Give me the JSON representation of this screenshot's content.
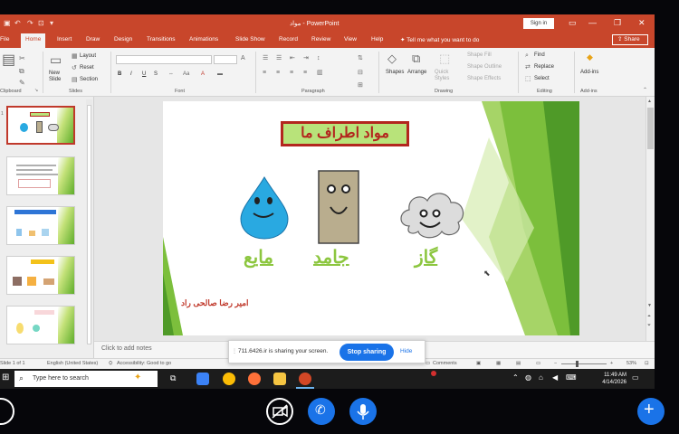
{
  "window": {
    "title": "مواد - PowerPoint",
    "sign_in": "Sign in",
    "share": "Share",
    "tell_me": "Tell me what you want to do"
  },
  "tabs": [
    "File",
    "Home",
    "Insert",
    "Draw",
    "Design",
    "Transitions",
    "Animations",
    "Slide Show",
    "Record",
    "Review",
    "View",
    "Help"
  ],
  "ribbon": {
    "clipboard_label": "Clipboard",
    "slides": {
      "new_slide": "New Slide",
      "layout": "Layout",
      "reset": "Reset",
      "section": "Section",
      "label": "Slides"
    },
    "font": {
      "bold": "B",
      "italic": "I",
      "underline": "U",
      "strike": "S",
      "label": "Font"
    },
    "paragraph_label": "Paragraph",
    "drawing": {
      "shapes": "Shapes",
      "arrange": "Arrange",
      "quick_styles": "Quick Styles",
      "fill": "Shape Fill",
      "outline": "Shape Outline",
      "effects": "Shape Effects",
      "label": "Drawing"
    },
    "editing": {
      "find": "Find",
      "replace": "Replace",
      "select": "Select",
      "label": "Editing"
    },
    "addins": {
      "button": "Add-ins",
      "label": "Add-ins"
    }
  },
  "slide": {
    "title": "مواد اطراف ما",
    "words": {
      "liquid": "مایع",
      "solid": "جامد",
      "gas": "گاز"
    },
    "author": "امیر رضا صالحی راد",
    "colors": {
      "title_bg": "#b8e37a",
      "title_border": "#b3261e",
      "word": "#8cc63f",
      "drop": "#29a9e1",
      "block": "#b9ad8e",
      "cloud": "#dcdcdc"
    }
  },
  "notes": {
    "placeholder": "Click to add notes"
  },
  "status": {
    "slide": "Slide 1 of 1",
    "language": "English (United States)",
    "accessibility": "Accessibility: Good to go",
    "comments": "Comments",
    "zoom": "53%"
  },
  "sharing": {
    "message": "711.6426.ir is sharing your screen.",
    "stop": "Stop sharing",
    "hide": "Hide"
  },
  "taskbar": {
    "search": "Type here to search",
    "time": "11:49 AM",
    "date": "4/14/2026"
  }
}
